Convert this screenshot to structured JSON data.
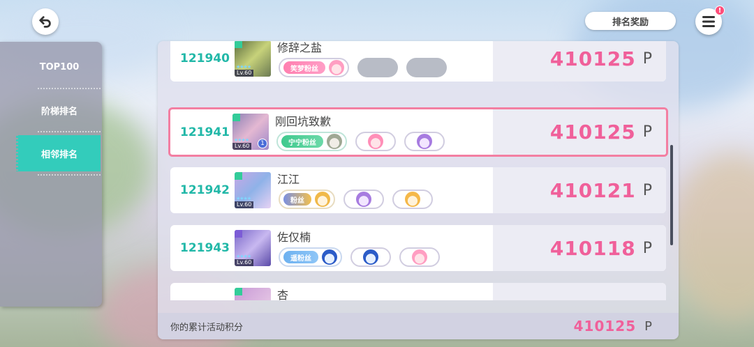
{
  "header": {
    "rank_reward_label": "排名奖励",
    "menu_badge": "!"
  },
  "sidebar": {
    "items": [
      {
        "label": "TOP100",
        "active": false
      },
      {
        "label": "阶梯排名",
        "active": false
      },
      {
        "label": "相邻排名",
        "active": true
      }
    ]
  },
  "ranking": {
    "rows": [
      {
        "rank": "121940",
        "name": "修辞之盐",
        "level": "Lv.60",
        "fan_label": "笑梦粉丝",
        "score": "410125",
        "unit": "P",
        "highlight": false
      },
      {
        "rank": "121941",
        "name": "刚回坑致歉",
        "level": "Lv.60",
        "fan_label": "宁宁粉丝",
        "score": "410125",
        "unit": "P",
        "highlight": true,
        "badge": "1"
      },
      {
        "rank": "121942",
        "name": "江江",
        "level": "Lv.60",
        "fan_label": "粉丝",
        "score": "410121",
        "unit": "P",
        "highlight": false
      },
      {
        "rank": "121943",
        "name": "佐仅楠",
        "level": "Lv.60",
        "fan_label": "遥粉丝",
        "score": "410118",
        "unit": "P",
        "highlight": false
      },
      {
        "rank": "",
        "name": "杏",
        "level": "",
        "fan_label": "",
        "score": "",
        "unit": "",
        "highlight": false
      }
    ]
  },
  "footer": {
    "label": "你的累计活动积分",
    "score": "410125",
    "unit": "P"
  },
  "colors": {
    "accent_teal": "#33ccbb",
    "score_pink": "#f0609a",
    "highlight_border": "#f37fa2"
  }
}
